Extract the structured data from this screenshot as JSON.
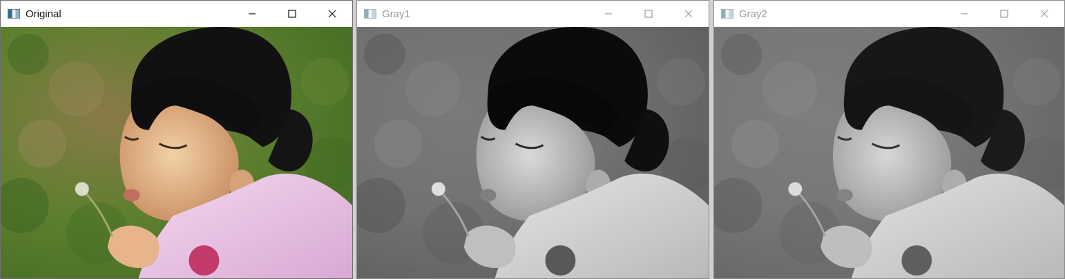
{
  "windows": [
    {
      "title": "Original",
      "active": true
    },
    {
      "title": "Gray1",
      "active": false
    },
    {
      "title": "Gray2",
      "active": false
    }
  ],
  "controls": {
    "minimize_icon": "minimize-icon",
    "maximize_icon": "maximize-icon",
    "close_icon": "close-icon"
  },
  "colors": {
    "titlebar_bg": "#ffffff",
    "active_title": "#111111",
    "inactive_title": "#9a9a9a"
  }
}
